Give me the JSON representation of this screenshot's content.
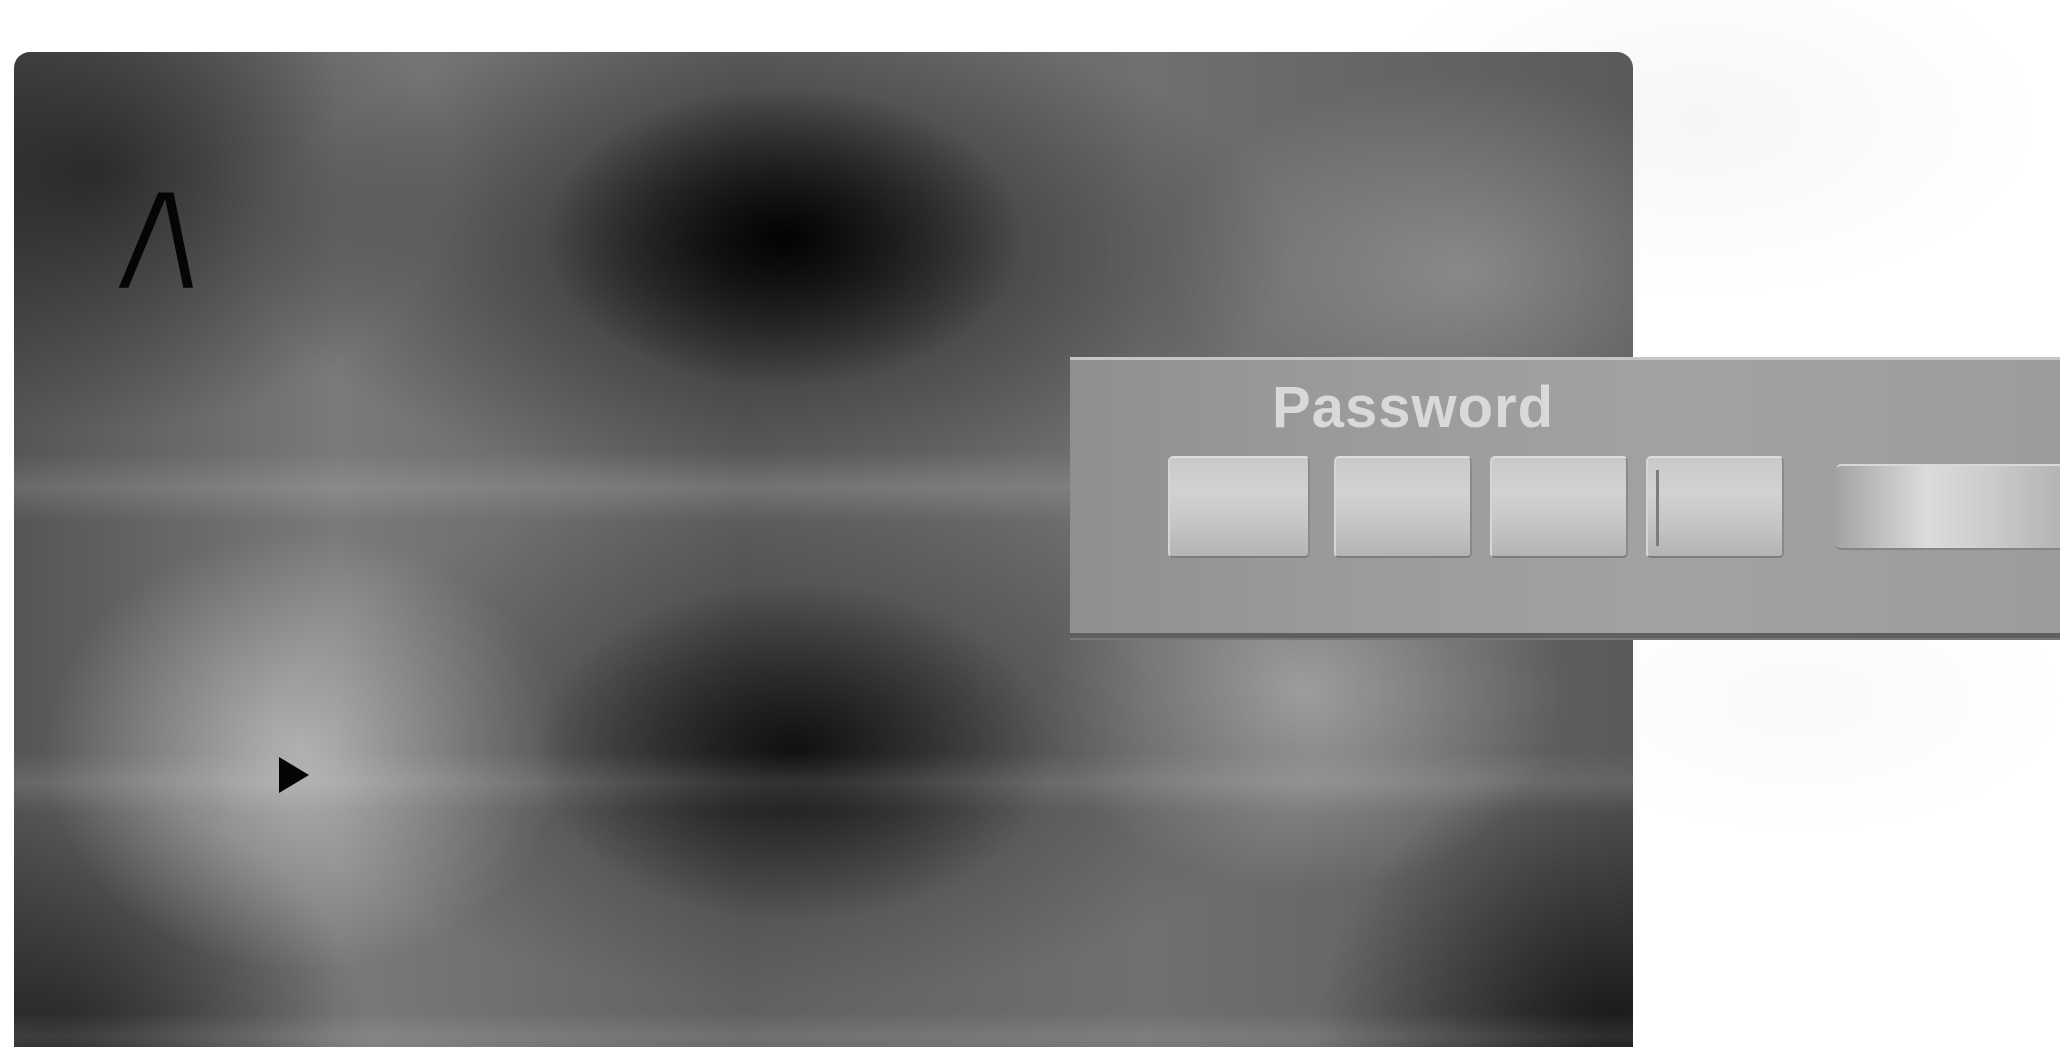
{
  "screen": {
    "corner_glyph": "/\\"
  },
  "dialog": {
    "title": "Password",
    "digit_count": 4
  },
  "icons": {
    "cursor": "play-cursor-icon"
  }
}
